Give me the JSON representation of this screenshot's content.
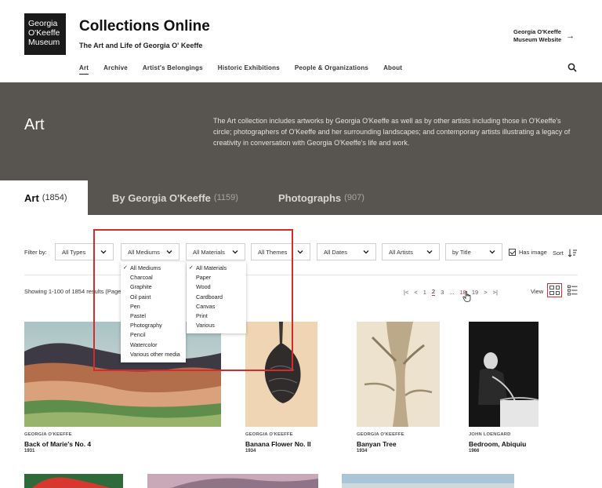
{
  "header": {
    "logo_lines": [
      "Georgia",
      "O'Keeffe",
      "Museum"
    ],
    "title": "Collections Online",
    "subtitle": "The Art and Life of Georgia O' Keeffe",
    "museum_link": [
      "Georgia O'Keeffe",
      "Museum Website"
    ]
  },
  "nav": {
    "items": [
      {
        "label": "Art",
        "active": true
      },
      {
        "label": "Archive"
      },
      {
        "label": "Artist's Belongings"
      },
      {
        "label": "Historic Exhibitions"
      },
      {
        "label": "People & Organizations"
      },
      {
        "label": "About"
      }
    ]
  },
  "hero": {
    "title": "Art",
    "description": "The Art collection includes artworks by Georgia O'Keeffe as well as by other artists including those in O'Keeffe's circle; photographers of O'Keeffe and her surrounding landscapes; and contemporary artists illustrating a legacy of creativity in conversation with Georgia O'Keeffe's life and work.",
    "color": "#58544f"
  },
  "tabs": [
    {
      "label": "Art",
      "count": "(1854)"
    },
    {
      "label": "By Georgia O'Keeffe",
      "count": "(1159)"
    },
    {
      "label": "Photographs",
      "count": "(907)"
    }
  ],
  "filters": {
    "label": "Filter by:",
    "selects": [
      "All Types",
      "All Mediums",
      "All Materials",
      "All Themes",
      "All Dates",
      "All Artists",
      "by Title"
    ],
    "has_image": "Has image",
    "sort": "Sort"
  },
  "mediums_menu": [
    "All Mediums",
    "Charcoal",
    "Graphite",
    "Oil paint",
    "Pen",
    "Pastel",
    "Photography",
    "Pencil",
    "Watercolor",
    "Various other media"
  ],
  "materials_menu": [
    "All Materials",
    "Paper",
    "Wood",
    "Cardboard",
    "Canvas",
    "Print",
    "Various"
  ],
  "results": {
    "showing": "Showing 1-100 of 1854 results (Page",
    "pages": [
      "1",
      "2",
      "3",
      "...",
      "18",
      "19"
    ],
    "view": "View"
  },
  "cards": [
    {
      "artist": "GEORGIA O'KEEFFE",
      "title": "Back of Marie's No. 4",
      "year": "1931"
    },
    {
      "artist": "GEORGIA O'KEEFFE",
      "title": "Banana Flower No. II",
      "year": "1934"
    },
    {
      "artist": "GEORGIA O'KEEFFE",
      "title": "Banyan Tree",
      "year": "1934"
    },
    {
      "artist": "JOHN LOENGARD",
      "title": "Bedroom, Abiquiu",
      "year": "1966"
    }
  ],
  "accent_color": "#d62b2b"
}
